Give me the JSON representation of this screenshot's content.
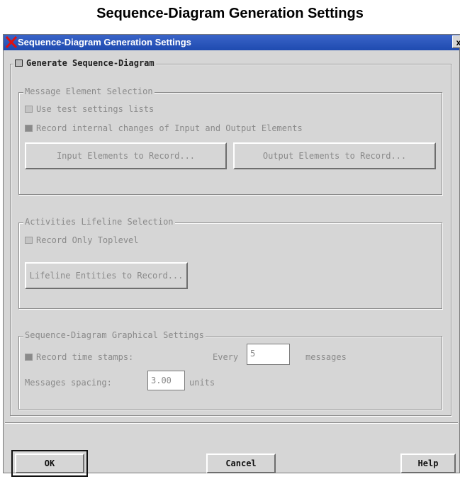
{
  "page_heading": "Sequence-Diagram Generation Settings",
  "window": {
    "title": "Sequence-Diagram Generation Settings",
    "close_glyph": "x"
  },
  "main_toggle": {
    "label": "Generate Sequence-Diagram",
    "checked": false
  },
  "message_selection": {
    "legend": "Message Element Selection",
    "use_test_settings": {
      "label": "Use test settings lists",
      "checked": false
    },
    "record_internal": {
      "label": "Record internal changes of Input and Output Elements",
      "checked": true
    },
    "input_button": "Input Elements to Record...",
    "output_button": "Output Elements to Record..."
  },
  "lifeline_selection": {
    "legend": "Activities Lifeline Selection",
    "record_toplevel": {
      "label": "Record Only Toplevel",
      "checked": false
    },
    "lifeline_button": "Lifeline Entities to Record..."
  },
  "graphical_settings": {
    "legend": "Sequence-Diagram Graphical Settings",
    "timestamps": {
      "label": "Record time stamps:",
      "checked": true
    },
    "every_label": "Every",
    "every_value": "5",
    "messages_label": "messages",
    "spacing_label": "Messages spacing:",
    "spacing_value": "3.00",
    "units_label": "units"
  },
  "footer": {
    "ok": "OK",
    "cancel": "Cancel",
    "help": "Help"
  },
  "colors": {
    "titlebar": "#1f4bb0",
    "dialog_bg": "#d6d6d6",
    "close_x_logo": "#e01010"
  }
}
